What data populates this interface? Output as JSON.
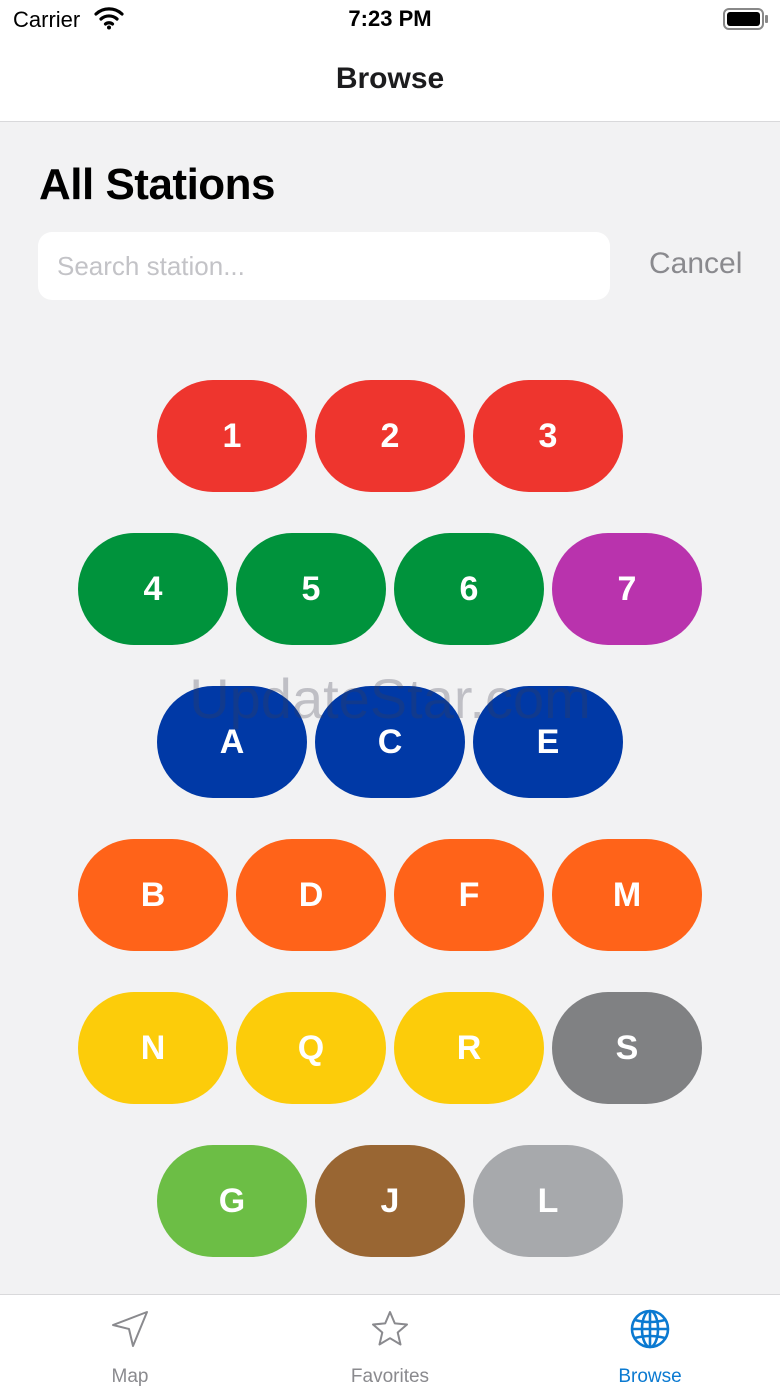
{
  "status_bar": {
    "carrier": "Carrier",
    "time": "7:23 PM"
  },
  "nav": {
    "title": "Browse"
  },
  "page": {
    "title": "All Stations"
  },
  "search": {
    "placeholder": "Search station...",
    "value": "",
    "cancel_label": "Cancel"
  },
  "line_rows": [
    [
      {
        "label": "1",
        "color": "#ee352e"
      },
      {
        "label": "2",
        "color": "#ee352e"
      },
      {
        "label": "3",
        "color": "#ee352e"
      }
    ],
    [
      {
        "label": "4",
        "color": "#00933c"
      },
      {
        "label": "5",
        "color": "#00933c"
      },
      {
        "label": "6",
        "color": "#00933c"
      },
      {
        "label": "7",
        "color": "#b933ad"
      }
    ],
    [
      {
        "label": "A",
        "color": "#0039a6"
      },
      {
        "label": "C",
        "color": "#0039a6"
      },
      {
        "label": "E",
        "color": "#0039a6"
      }
    ],
    [
      {
        "label": "B",
        "color": "#ff6319"
      },
      {
        "label": "D",
        "color": "#ff6319"
      },
      {
        "label": "F",
        "color": "#ff6319"
      },
      {
        "label": "M",
        "color": "#ff6319"
      }
    ],
    [
      {
        "label": "N",
        "color": "#fccc0a"
      },
      {
        "label": "Q",
        "color": "#fccc0a"
      },
      {
        "label": "R",
        "color": "#fccc0a"
      },
      {
        "label": "S",
        "color": "#808183"
      }
    ],
    [
      {
        "label": "G",
        "color": "#6cbe45"
      },
      {
        "label": "J",
        "color": "#996633"
      },
      {
        "label": "L",
        "color": "#a7a9ac"
      }
    ]
  ],
  "watermark": "UpdateStar.com",
  "tabs": [
    {
      "label": "Map",
      "icon": "location-arrow-icon",
      "active": false
    },
    {
      "label": "Favorites",
      "icon": "star-icon",
      "active": false
    },
    {
      "label": "Browse",
      "icon": "globe-icon",
      "active": true
    }
  ],
  "colors": {
    "accent": "#0b7ad1",
    "background": "#f2f2f3",
    "inactive": "#8a8a8e"
  }
}
